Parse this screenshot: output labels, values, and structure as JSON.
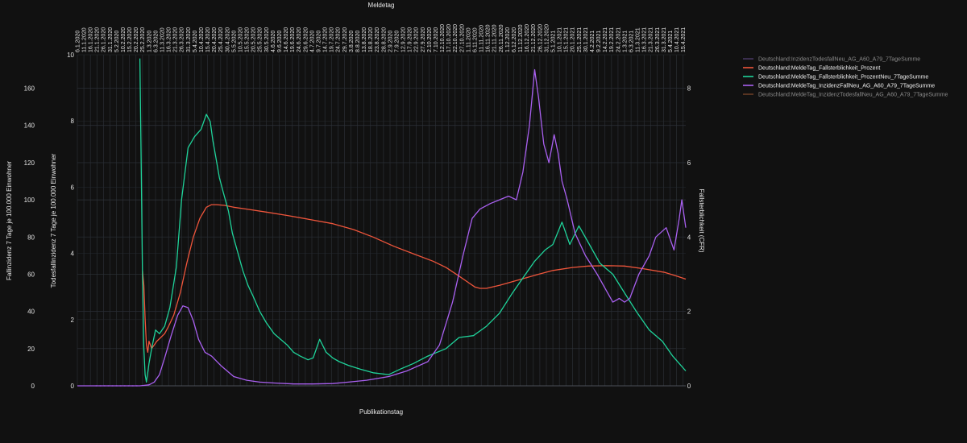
{
  "chart_data": {
    "type": "line",
    "title": "Meldetag",
    "xlabel": "Publikationstag",
    "ylabel_left_outer": "Fallinzidenz 7 Tage je 100.000 Einwohner",
    "ylabel_left_inner": "Todesfallinzidenz 7 Tage je 100.000 Einwohner",
    "ylabel_right": "Fallsterblichkeit (CFR)",
    "x_tick_labels": [
      "6.1.2020",
      "11.1.2020",
      "16.1.2020",
      "21.1.2020",
      "26.1.2020",
      "31.1.2020",
      "5.2.2020",
      "10.2.2020",
      "15.2.2020",
      "20.2.2020",
      "25.2.2020",
      "1.3.2020",
      "6.3.2020",
      "11.3.2020",
      "16.3.2020",
      "21.3.2020",
      "26.3.2020",
      "31.3.2020",
      "5.4.2020",
      "10.4.2020",
      "15.4.2020",
      "20.4.2020",
      "25.4.2020",
      "30.4.2020",
      "5.5.2020",
      "10.5.2020",
      "15.5.2020",
      "20.5.2020",
      "25.5.2020",
      "30.5.2020",
      "4.6.2020",
      "9.6.2020",
      "14.6.2020",
      "19.6.2020",
      "24.6.2020",
      "29.6.2020",
      "4.7.2020",
      "9.7.2020",
      "14.7.2020",
      "19.7.2020",
      "24.7.2020",
      "29.7.2020",
      "3.8.2020",
      "8.8.2020",
      "13.8.2020",
      "18.8.2020",
      "23.8.2020",
      "28.8.2020",
      "2.9.2020",
      "7.9.2020",
      "12.9.2020",
      "17.9.2020",
      "22.9.2020",
      "27.9.2020",
      "2.10.2020",
      "7.10.2020",
      "12.10.2020",
      "17.10.2020",
      "22.10.2020",
      "27.10.2020",
      "1.11.2020",
      "6.11.2020",
      "11.11.2020",
      "16.11.2020",
      "21.11.2020",
      "26.11.2020",
      "1.12.2020",
      "6.12.2020",
      "11.12.2020",
      "16.12.2020",
      "21.12.2020",
      "26.12.2020",
      "31.12.2020",
      "5.1.2021",
      "10.1.2021",
      "15.1.2021",
      "20.1.2021",
      "25.1.2021",
      "30.1.2021",
      "4.2.2021",
      "9.2.2021",
      "14.2.2021",
      "19.2.2021",
      "24.2.2021",
      "1.3.2021",
      "6.3.2021",
      "11.3.2021",
      "16.3.2021",
      "21.3.2021",
      "26.3.2021",
      "31.3.2021",
      "5.4.2021",
      "10.4.2021",
      "15.4.2021"
    ],
    "x_range": [
      "2020-01-06",
      "2021-04-17"
    ],
    "y_left_outer": {
      "range": [
        0,
        178
      ],
      "ticks": [
        0,
        20,
        40,
        60,
        80,
        100,
        120,
        140,
        160
      ]
    },
    "y_left_inner": {
      "range": [
        0,
        10
      ],
      "ticks": [
        0,
        2,
        4,
        6,
        8,
        10
      ]
    },
    "y_right": {
      "range": [
        0,
        8.9
      ],
      "ticks": [
        0,
        2,
        4,
        6,
        8
      ]
    },
    "grid": true,
    "legend_position": "top-right",
    "series": [
      {
        "name": "Deutschland:InzidenzTodesfallNeu_AG_A60_A79_7TageSumme",
        "color": "#7a5ba8",
        "axis": "inner",
        "dimmed": true,
        "x": [
          "2020-01-06"
        ],
        "y": [
          0
        ]
      },
      {
        "name": "Deutschland:MeldeTag_Fallsterblichkeit_Prozent",
        "color": "#ef553b",
        "axis": "right",
        "dimmed": false,
        "x": [
          "2020-02-25",
          "2020-02-26",
          "2020-02-27",
          "2020-02-28",
          "2020-02-29",
          "2020-03-01",
          "2020-03-03",
          "2020-03-05",
          "2020-03-07",
          "2020-03-10",
          "2020-03-13",
          "2020-03-16",
          "2020-03-20",
          "2020-03-25",
          "2020-03-30",
          "2020-04-04",
          "2020-04-09",
          "2020-04-14",
          "2020-04-18",
          "2020-04-22",
          "2020-04-28",
          "2020-05-05",
          "2020-05-15",
          "2020-05-30",
          "2020-06-15",
          "2020-07-01",
          "2020-07-20",
          "2020-08-05",
          "2020-08-20",
          "2020-09-05",
          "2020-09-20",
          "2020-10-05",
          "2020-10-15",
          "2020-10-25",
          "2020-11-01",
          "2020-11-06",
          "2020-11-10",
          "2020-11-15",
          "2020-11-25",
          "2020-12-10",
          "2020-12-25",
          "2021-01-05",
          "2021-01-20",
          "2021-02-01",
          "2021-02-15",
          "2021-03-01",
          "2021-03-15",
          "2021-04-01",
          "2021-04-10",
          "2021-04-17"
        ],
        "y": [
          3.1,
          2.7,
          1.8,
          1.1,
          0.9,
          1.2,
          1.0,
          1.1,
          1.2,
          1.3,
          1.4,
          1.6,
          1.9,
          2.5,
          3.3,
          4.0,
          4.5,
          4.8,
          4.87,
          4.87,
          4.85,
          4.8,
          4.75,
          4.67,
          4.58,
          4.48,
          4.36,
          4.2,
          4.0,
          3.75,
          3.55,
          3.35,
          3.18,
          2.95,
          2.78,
          2.66,
          2.62,
          2.62,
          2.7,
          2.85,
          3.0,
          3.1,
          3.18,
          3.22,
          3.23,
          3.22,
          3.15,
          3.05,
          2.95,
          2.87
        ]
      },
      {
        "name": "Deutschland:MeldeTag_Fallsterblichkeit_ProzentNeu_7TageSumme",
        "color": "#1fd39a",
        "axis": "right",
        "dimmed": false,
        "x": [
          "2020-02-23",
          "2020-02-24",
          "2020-02-25",
          "2020-02-26",
          "2020-02-27",
          "2020-02-28",
          "2020-03-01",
          "2020-03-03",
          "2020-03-06",
          "2020-03-09",
          "2020-03-13",
          "2020-03-17",
          "2020-03-22",
          "2020-03-26",
          "2020-03-31",
          "2020-04-05",
          "2020-04-10",
          "2020-04-14",
          "2020-04-17",
          "2020-04-19",
          "2020-04-21",
          "2020-04-24",
          "2020-04-27",
          "2020-05-01",
          "2020-05-04",
          "2020-05-08",
          "2020-05-12",
          "2020-05-16",
          "2020-05-20",
          "2020-05-25",
          "2020-05-30",
          "2020-06-05",
          "2020-06-10",
          "2020-06-15",
          "2020-06-20",
          "2020-06-25",
          "2020-07-01",
          "2020-07-05",
          "2020-07-10",
          "2020-07-15",
          "2020-07-20",
          "2020-07-25",
          "2020-08-01",
          "2020-08-10",
          "2020-08-20",
          "2020-09-01",
          "2020-09-10",
          "2020-09-20",
          "2020-10-01",
          "2020-10-15",
          "2020-10-25",
          "2020-11-05",
          "2020-11-15",
          "2020-11-25",
          "2020-12-05",
          "2020-12-15",
          "2020-12-22",
          "2020-12-26",
          "2020-12-30",
          "2021-01-05",
          "2021-01-12",
          "2021-01-18",
          "2021-01-25",
          "2021-02-02",
          "2021-02-10",
          "2021-02-20",
          "2021-03-01",
          "2021-03-10",
          "2021-03-20",
          "2021-03-30",
          "2021-04-07",
          "2021-04-12",
          "2021-04-17"
        ],
        "y": [
          8.8,
          6.0,
          3.0,
          1.0,
          0.3,
          0.1,
          0.6,
          1.0,
          1.5,
          1.4,
          1.6,
          2.1,
          3.2,
          5.0,
          6.4,
          6.7,
          6.9,
          7.3,
          7.1,
          6.6,
          6.2,
          5.6,
          5.2,
          4.7,
          4.1,
          3.6,
          3.1,
          2.7,
          2.4,
          2.0,
          1.7,
          1.4,
          1.25,
          1.1,
          0.9,
          0.8,
          0.7,
          0.75,
          1.25,
          0.9,
          0.75,
          0.65,
          0.55,
          0.45,
          0.35,
          0.3,
          0.45,
          0.6,
          0.8,
          1.0,
          1.3,
          1.35,
          1.6,
          1.95,
          2.5,
          3.0,
          3.35,
          3.5,
          3.65,
          3.8,
          4.4,
          3.8,
          4.3,
          3.8,
          3.3,
          3.0,
          2.5,
          2.0,
          1.5,
          1.2,
          0.8,
          0.6,
          0.4
        ]
      },
      {
        "name": "Deutschland:MeldeTag_InzidenzFallNeu_AG_A60_A79_7TageSumme",
        "color": "#a960f0",
        "axis": "outer",
        "dimmed": false,
        "x": [
          "2020-01-06",
          "2020-02-23",
          "2020-03-01",
          "2020-03-05",
          "2020-03-09",
          "2020-03-13",
          "2020-03-18",
          "2020-03-23",
          "2020-03-27",
          "2020-03-31",
          "2020-04-04",
          "2020-04-08",
          "2020-04-13",
          "2020-04-18",
          "2020-04-25",
          "2020-05-05",
          "2020-05-15",
          "2020-05-25",
          "2020-06-05",
          "2020-06-20",
          "2020-07-05",
          "2020-07-20",
          "2020-08-01",
          "2020-08-15",
          "2020-09-01",
          "2020-09-15",
          "2020-10-01",
          "2020-10-10",
          "2020-10-20",
          "2020-10-28",
          "2020-11-04",
          "2020-11-10",
          "2020-11-18",
          "2020-11-25",
          "2020-12-02",
          "2020-12-08",
          "2020-12-13",
          "2020-12-18",
          "2020-12-22",
          "2020-12-25",
          "2020-12-29",
          "2021-01-02",
          "2021-01-06",
          "2021-01-09",
          "2021-01-12",
          "2021-01-16",
          "2021-01-22",
          "2021-01-30",
          "2021-02-08",
          "2021-02-16",
          "2021-02-20",
          "2021-02-25",
          "2021-03-01",
          "2021-03-05",
          "2021-03-12",
          "2021-03-20",
          "2021-03-25",
          "2021-04-02",
          "2021-04-08",
          "2021-04-12",
          "2021-04-14",
          "2021-04-17"
        ],
        "y": [
          0,
          0,
          0.5,
          2,
          6,
          15,
          27,
          38,
          43,
          42,
          35,
          25,
          18,
          16,
          11,
          5,
          3,
          2,
          1.5,
          1,
          1,
          1.2,
          2,
          3,
          5,
          8,
          13,
          22,
          45,
          70,
          90,
          95,
          98,
          100,
          102,
          100,
          115,
          140,
          170,
          155,
          130,
          120,
          135,
          125,
          110,
          100,
          82,
          70,
          60,
          50,
          45,
          47,
          45,
          47,
          60,
          70,
          80,
          85,
          73,
          90,
          100,
          85
        ]
      }
    ]
  },
  "legend_items": [
    {
      "label": "Deutschland:InzidenzTodesfallNeu_AG_A60_A79_7TageSumme",
      "color": "#7a5ba8",
      "dimmed": true
    },
    {
      "label": "Deutschland:MeldeTag_Fallsterblichkeit_Prozent",
      "color": "#ef553b",
      "dimmed": false
    },
    {
      "label": "Deutschland:MeldeTag_Fallsterblichkeit_ProzentNeu_7TageSumme",
      "color": "#1fd39a",
      "dimmed": false
    },
    {
      "label": "Deutschland:MeldeTag_InzidenzFallNeu_AG_A60_A79_7TageSumme",
      "color": "#a960f0",
      "dimmed": false
    },
    {
      "label": "Deutschland:MeldeTag_InzidenzTodesfallNeu_AG_A60_A79_7TageSumme",
      "color": "#c2683a",
      "dimmed": true
    }
  ]
}
